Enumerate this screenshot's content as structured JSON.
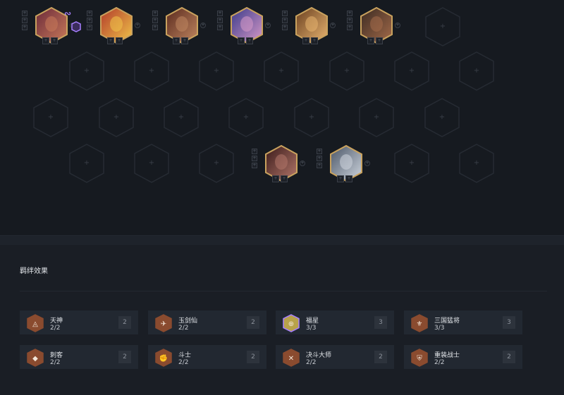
{
  "board": {
    "champions": [
      {
        "name": "champion-1",
        "chosen": true,
        "linked": true
      },
      {
        "name": "champion-2"
      },
      {
        "name": "champion-3"
      },
      {
        "name": "champion-4"
      },
      {
        "name": "champion-5"
      },
      {
        "name": "champion-6"
      },
      {
        "name": "champion-7"
      },
      {
        "name": "champion-8"
      }
    ],
    "empty_slot_glyph": "+",
    "pin_glyphs": [
      "+",
      "+",
      "+"
    ],
    "item_glyphs": [
      "+",
      "+"
    ],
    "dot_glyph": "+",
    "link_icon": "link-icon",
    "chosen_icon": "chosen-badge-icon"
  },
  "traits": {
    "title": "羁绊效果",
    "items": [
      {
        "name": "天神",
        "count": "2/2",
        "level": "2",
        "icon": "deity-icon",
        "color": "#8a4b2f"
      },
      {
        "name": "玉剑仙",
        "count": "2/2",
        "level": "2",
        "icon": "jade-sword-icon",
        "color": "#8a4b2f"
      },
      {
        "name": "福星",
        "count": "3/3",
        "level": "3",
        "icon": "fortune-icon",
        "color": "#b8a24a"
      },
      {
        "name": "三国猛将",
        "count": "3/3",
        "level": "3",
        "icon": "warlord-icon",
        "color": "#8a4b2f"
      },
      {
        "name": "刺客",
        "count": "2/2",
        "level": "2",
        "icon": "assassin-icon",
        "color": "#8a4b2f"
      },
      {
        "name": "斗士",
        "count": "2/2",
        "level": "2",
        "icon": "brawler-icon",
        "color": "#8a4b2f"
      },
      {
        "name": "决斗大师",
        "count": "2/2",
        "level": "2",
        "icon": "duelist-icon",
        "color": "#8a4b2f"
      },
      {
        "name": "重装战士",
        "count": "2/2",
        "level": "2",
        "icon": "vanguard-icon",
        "color": "#8a4b2f"
      }
    ]
  }
}
